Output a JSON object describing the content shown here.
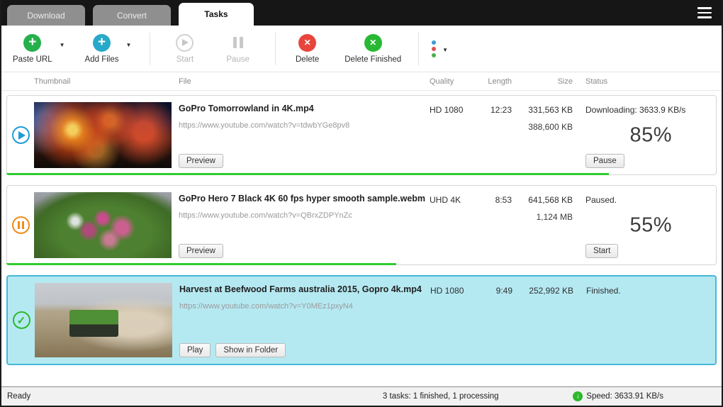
{
  "app": {
    "tabs": [
      {
        "label": "Download"
      },
      {
        "label": "Convert"
      },
      {
        "label": "Tasks"
      }
    ]
  },
  "toolbar": {
    "buttons": [
      {
        "label": "Paste URL"
      },
      {
        "label": "Add Files"
      },
      {
        "label": "Start"
      },
      {
        "label": "Pause"
      },
      {
        "label": "Delete"
      },
      {
        "label": "Delete Finished"
      }
    ]
  },
  "table": {
    "headers": [
      "Thumbnail",
      "File",
      "Quality",
      "Length",
      "Size",
      "Status"
    ]
  },
  "tasks": [
    {
      "title": "GoPro  Tomorrowland in 4K.mp4",
      "url": "https://www.youtube.com/watch?v=tdwbYGe8pv8",
      "quality": "HD 1080",
      "length": "12:23",
      "size_downloaded": "331,563 KB",
      "size_total": "388,600 KB",
      "status": "Downloading: 3633.9 KB/s",
      "percent_label": "85%",
      "progress": 85,
      "buttons": [
        "Preview"
      ],
      "action": "Pause"
    },
    {
      "title": "GoPro Hero 7 Black 4K 60 fps hyper smooth sample.webm",
      "url": "https://www.youtube.com/watch?v=QBrxZDPYnZc",
      "quality": "UHD 4K",
      "length": "8:53",
      "size_downloaded": "641,568 KB",
      "size_total": "1,124 MB",
      "status": "Paused.",
      "percent_label": "55%",
      "progress": 55,
      "buttons": [
        "Preview"
      ],
      "action": "Start"
    },
    {
      "title": "Harvest at Beefwood Farms australia 2015, Gopro 4k.mp4",
      "url": "https://www.youtube.com/watch?v=Y0MEz1pxyN4",
      "quality": "HD 1080",
      "length": "9:49",
      "size_downloaded": "252,992 KB",
      "status": "Finished.",
      "buttons": [
        "Play",
        "Show in Folder"
      ]
    }
  ],
  "statusbar": {
    "ready": "Ready",
    "summary": "3 tasks: 1 finished, 1 processing",
    "speed": "Speed: 3633.91 KB/s"
  },
  "colors": {
    "selection_bg": "#b5e9f2",
    "selection_border": "#46b8d8",
    "progress_green": "#2fcb2f",
    "downloading_blue": "#1e9cd7",
    "paused_orange": "#f08c1e",
    "finished_green": "#2eb82e"
  }
}
